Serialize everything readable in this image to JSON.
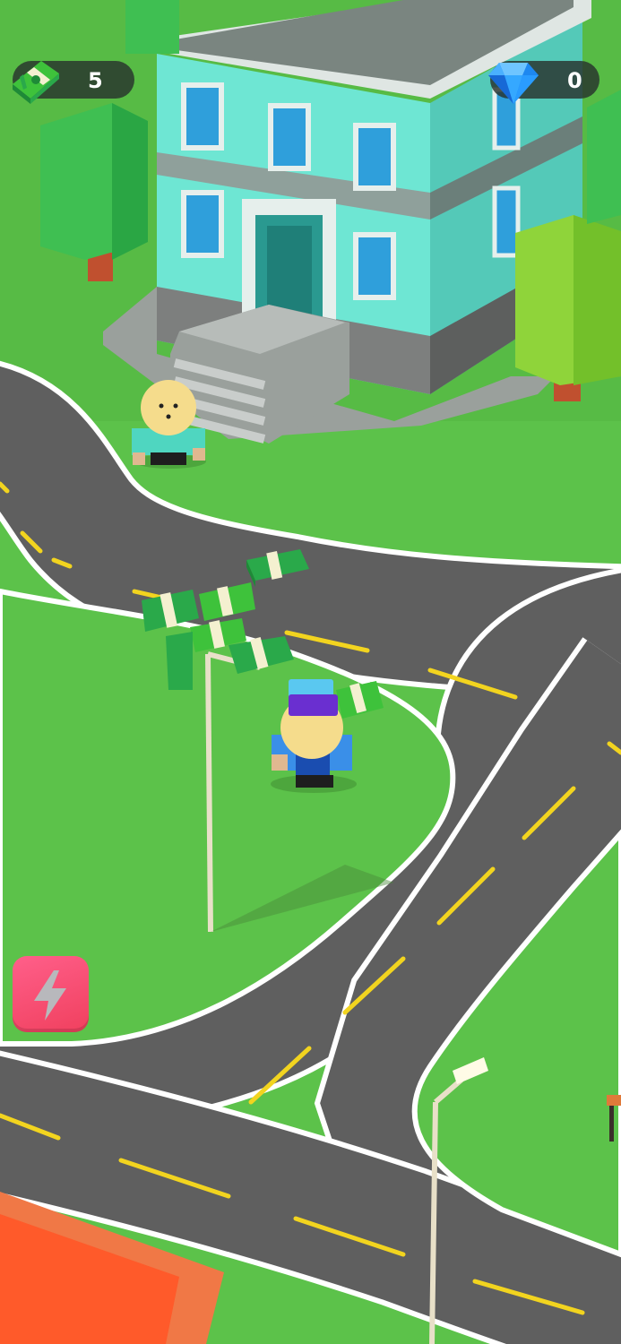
{
  "hud": {
    "cash": {
      "icon": "cash-stack-icon",
      "value": "5"
    },
    "gems": {
      "icon": "blue-diamond-icon",
      "value": "0"
    }
  },
  "actions": {
    "boost": {
      "icon": "lightning-bolt-icon"
    }
  },
  "colors": {
    "grass": "#5cc24a",
    "road": "#5f5f5f",
    "lane_marking": "#f2d41f",
    "building_wall": "#6ee6d3",
    "cash_green": "#3ec23b",
    "boost_button": "#f0405e",
    "hud_pill": "#28322d"
  }
}
